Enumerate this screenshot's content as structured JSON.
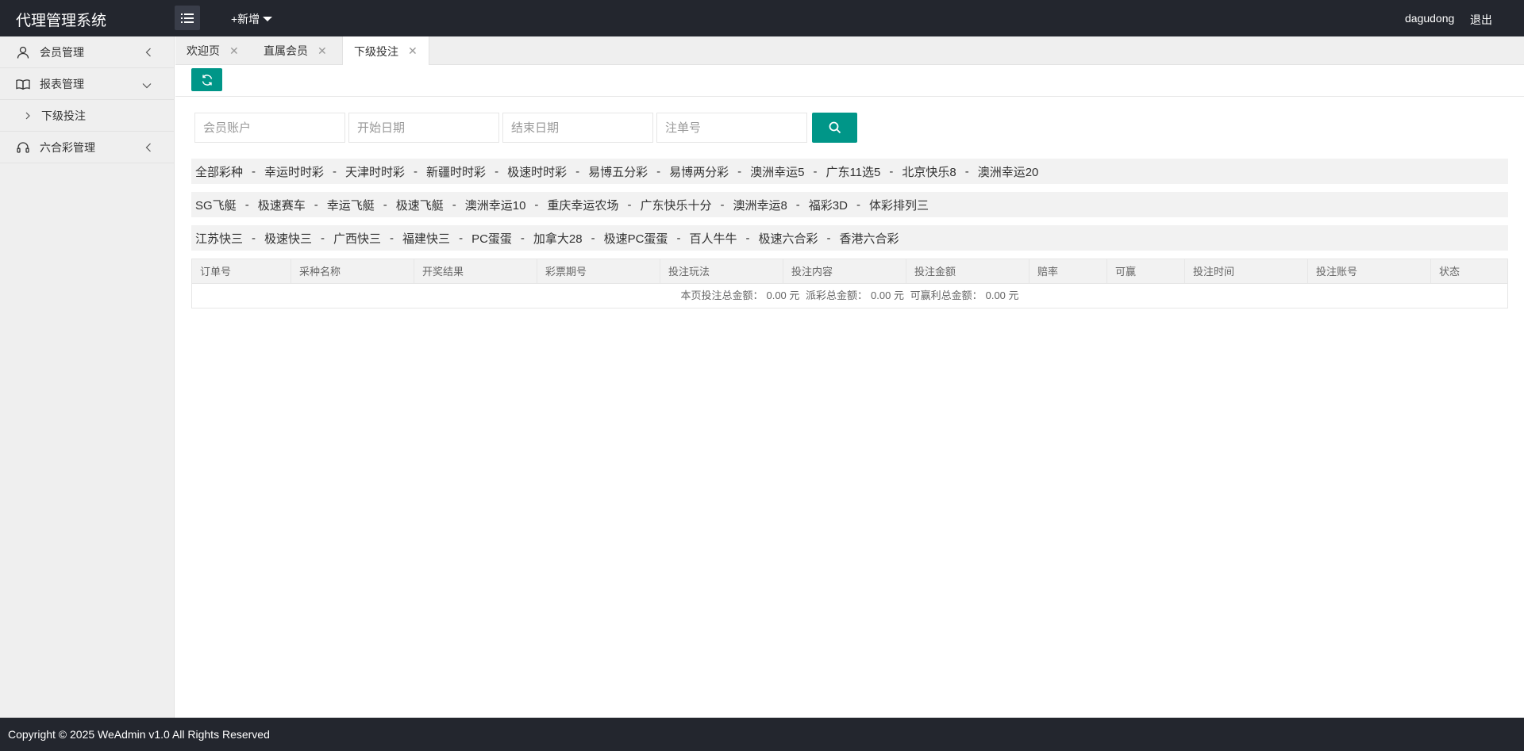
{
  "header": {
    "brand": "代理管理系统",
    "add_new": "+新增",
    "username": "dagudong",
    "logout": "退出"
  },
  "sidebar": {
    "items": [
      {
        "label": "会员管理",
        "icon": "user-icon",
        "arrow": "chevron-left-icon"
      },
      {
        "label": "报表管理",
        "icon": "book-icon",
        "arrow": "chevron-down-icon"
      },
      {
        "label": "六合彩管理",
        "icon": "headset-icon",
        "arrow": "chevron-left-icon"
      }
    ],
    "sub_items": [
      {
        "label": "下级投注",
        "icon": "chevron-right-icon"
      }
    ]
  },
  "tabs": [
    {
      "label": "欢迎页",
      "close": "✕"
    },
    {
      "label": "直属会员",
      "close": "✕"
    },
    {
      "label": "下级投注",
      "close": "✕",
      "active": true
    }
  ],
  "search": {
    "member_placeholder": "会员账户",
    "start_placeholder": "开始日期",
    "end_placeholder": "结束日期",
    "order_placeholder": "注单号"
  },
  "lottery_rows": [
    [
      "全部彩种",
      "幸运时时彩",
      "天津时时彩",
      "新疆时时彩",
      "极速时时彩",
      "易博五分彩",
      "易博两分彩",
      "澳洲幸运5",
      "广东11选5",
      "北京快乐8",
      "澳洲幸运20"
    ],
    [
      "SG飞艇",
      "极速赛车",
      "幸运飞艇",
      "极速飞艇",
      "澳洲幸运10",
      "重庆幸运农场",
      "广东快乐十分",
      "澳洲幸运8",
      "福彩3D",
      "体彩排列三"
    ],
    [
      "江苏快三",
      "极速快三",
      "广西快三",
      "福建快三",
      "PC蛋蛋",
      "加拿大28",
      "极速PC蛋蛋",
      "百人牛牛",
      "极速六合彩",
      "香港六合彩"
    ]
  ],
  "separator": "-",
  "table": {
    "columns": [
      "订单号",
      "采种名称",
      "开奖结果",
      "彩票期号",
      "投注玩法",
      "投注内容",
      "投注金额",
      "赔率",
      "可赢",
      "投注时间",
      "投注账号",
      "状态"
    ],
    "summary": {
      "bet_total_label": "本页投注总金额：",
      "bet_total": "0.00 元",
      "payout_total_label": "派彩总金额：",
      "payout_total": "0.00 元",
      "win_total_label": "可赢利总金额：",
      "win_total": "0.00 元"
    }
  },
  "footer": {
    "copyright": "Copyright © 2025 WeAdmin v1.0 All Rights Reserved"
  },
  "colors": {
    "header_bg": "#23262e",
    "accent": "#009688",
    "sidebar_bg": "#efefef"
  }
}
